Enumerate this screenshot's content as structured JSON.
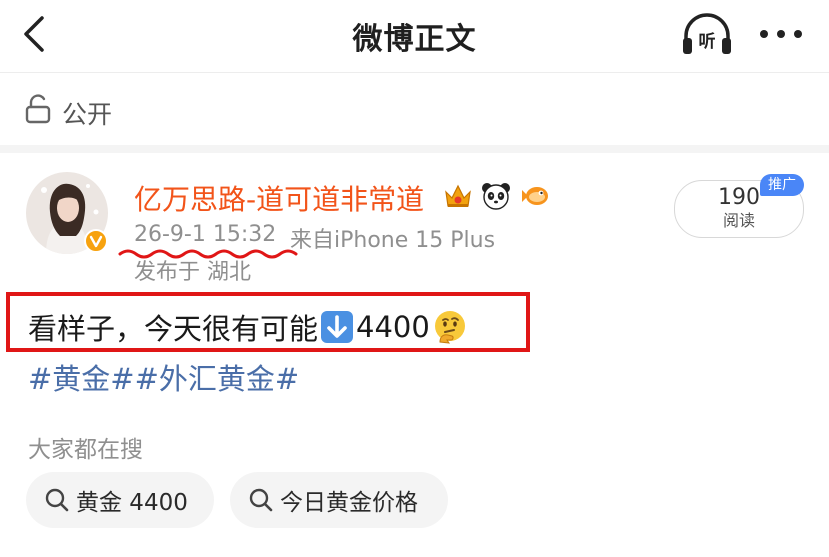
{
  "header": {
    "title": "微博正文",
    "listen_label": "听"
  },
  "visibility": {
    "label": "公开"
  },
  "post": {
    "author": "亿万思路-道可道非常道",
    "time": "26-9-1 15:32",
    "source": "来自iPhone 15 Plus",
    "location": "发布于 湖北",
    "read_count": "190",
    "read_label": "阅读",
    "promo_tag": "推广",
    "text_before": "看样子，今天很有可能",
    "text_after": "4400",
    "hashtags": [
      "#黄金#",
      "#外汇黄金#"
    ]
  },
  "trending": {
    "label": "大家都在搜",
    "chips": [
      "黄金 4400",
      "今日黄金价格"
    ]
  },
  "colors": {
    "author": "#f2541a",
    "hashtag": "#4a6ea8",
    "annotation_red": "#e01616",
    "promo_blue": "#4a86f7"
  }
}
